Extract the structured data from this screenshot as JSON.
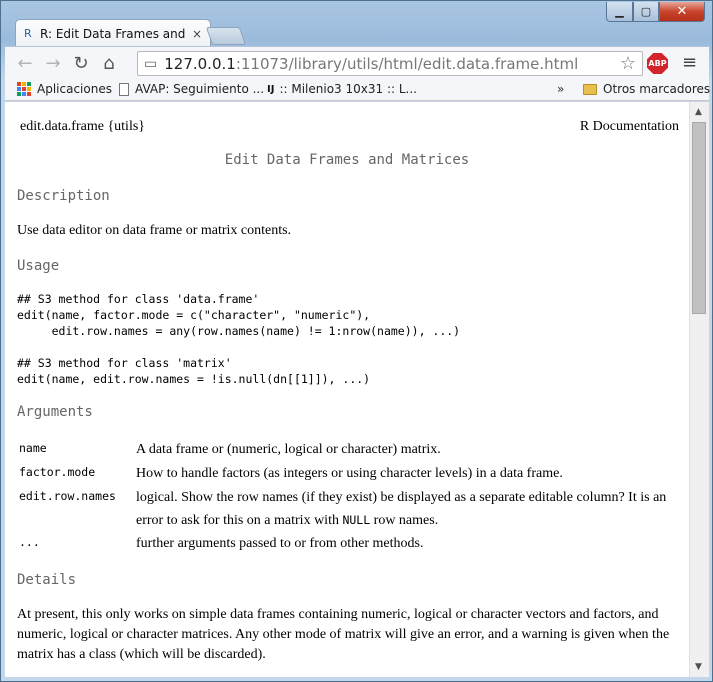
{
  "browser": {
    "tab_title": "R: Edit Data Frames and M",
    "tab_favicon": "R",
    "tab_close": "×",
    "window_controls": {
      "minimize": "▁",
      "maximize": "▢",
      "close": "✕"
    },
    "nav": {
      "back": "←",
      "forward": "→",
      "reload": "↻",
      "home": "⌂"
    },
    "url_host": "127.0.0.1",
    "url_rest": ":11073/library/utils/html/edit.data.frame.html",
    "star": "☆",
    "adblock_label": "ABP",
    "menu": "≡"
  },
  "bookmarks": {
    "apps": "Aplicaciones",
    "item1": "AVAP: Seguimiento ...",
    "item2_icon": "IJ",
    "item2": ":: Milenio3 10x31 :: L...",
    "more": "»",
    "other": "Otros marcadores"
  },
  "doc": {
    "header_left": "edit.data.frame {utils}",
    "header_right": "R Documentation",
    "title": "Edit Data Frames and Matrices",
    "description_heading": "Description",
    "description_text": "Use data editor on data frame or matrix contents.",
    "usage_heading": "Usage",
    "usage_code": "## S3 method for class 'data.frame'\nedit(name, factor.mode = c(\"character\", \"numeric\"),\n     edit.row.names = any(row.names(name) != 1:nrow(name)), ...)\n\n## S3 method for class 'matrix'\nedit(name, edit.row.names = !is.null(dn[[1]]), ...)",
    "arguments_heading": "Arguments",
    "arguments": [
      {
        "name": "name",
        "desc": "A data frame or (numeric, logical or character) matrix."
      },
      {
        "name": "factor.mode",
        "desc": "How to handle factors (as integers or using character levels) in a data frame."
      },
      {
        "name": "edit.row.names",
        "desc_before": "logical. Show the row names (if they exist) be displayed as a separate editable column? It is an error to ask for this on a matrix with ",
        "desc_code": "NULL",
        "desc_after": " row names."
      },
      {
        "name": "...",
        "desc": "further arguments passed to or from other methods."
      }
    ],
    "details_heading": "Details",
    "details_text": "At present, this only works on simple data frames containing numeric, logical or character vectors and factors, and numeric, logical or character matrices. Any other mode of matrix will give an error, and a warning is given when the matrix has a class (which will be discarded)."
  },
  "scrollbar": {
    "up": "▲",
    "down": "▼"
  },
  "colors": {
    "heading_gray": "#666666",
    "adblock_red": "#d3242a",
    "window_close_red": "#c8442d"
  }
}
